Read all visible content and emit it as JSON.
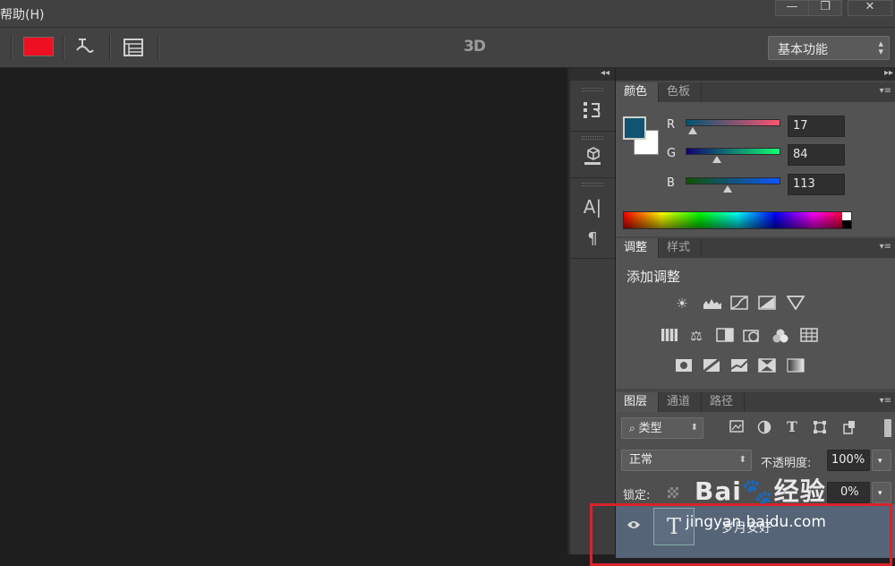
{
  "menubar": {
    "visible_item": "帮助(H)",
    "window_buttons": {
      "minimize": "—",
      "restore": "❐",
      "close": "✕"
    }
  },
  "optionsbar": {
    "foreground_swatch_color": "#ee1022",
    "label_3d": "3D",
    "workspace": "基本功能",
    "icons": [
      "warp-text-icon",
      "character-panel-icon"
    ]
  },
  "dock": {
    "icons": [
      "history-icon",
      "3d-panel-icon",
      "character-icon",
      "paragraph-icon"
    ]
  },
  "color_panel": {
    "tabs": [
      "颜色",
      "色板"
    ],
    "active_tab": "颜色",
    "foreground_color": "#115471",
    "background_color": "#ffffff",
    "channels": [
      {
        "label": "R",
        "value": "17"
      },
      {
        "label": "G",
        "value": "84"
      },
      {
        "label": "B",
        "value": "113"
      }
    ]
  },
  "adjustments_panel": {
    "tabs": [
      "调整",
      "样式"
    ],
    "active_tab": "调整",
    "title": "添加调整",
    "icon_rows": [
      [
        "brightness-icon",
        "levels-icon",
        "curves-icon",
        "exposure-icon",
        "vibrance-icon"
      ],
      [
        "hue-saturation-icon",
        "color-balance-icon",
        "black-white-icon",
        "photo-filter-icon",
        "channel-mixer-icon",
        "color-lookup-icon"
      ],
      [
        "invert-icon",
        "posterize-icon",
        "threshold-icon",
        "selective-color-icon",
        "gradient-map-icon"
      ]
    ]
  },
  "layers_panel": {
    "tabs": [
      "图层",
      "通道",
      "路径"
    ],
    "active_tab": "图层",
    "filter_kind": "类型",
    "blend_mode": "正常",
    "opacity_label": "不透明度:",
    "opacity_value": "100%",
    "lock_label": "锁定:",
    "fill_value": "0%",
    "layers": [
      {
        "name": "岁月安好",
        "type": "text",
        "visible": true
      }
    ]
  },
  "watermark": {
    "logo": "Bai🐾经验",
    "url": "jingyan.baidu.com"
  },
  "colors": {
    "highlight_box": "#d8232a",
    "selected_layer": "#556477"
  }
}
